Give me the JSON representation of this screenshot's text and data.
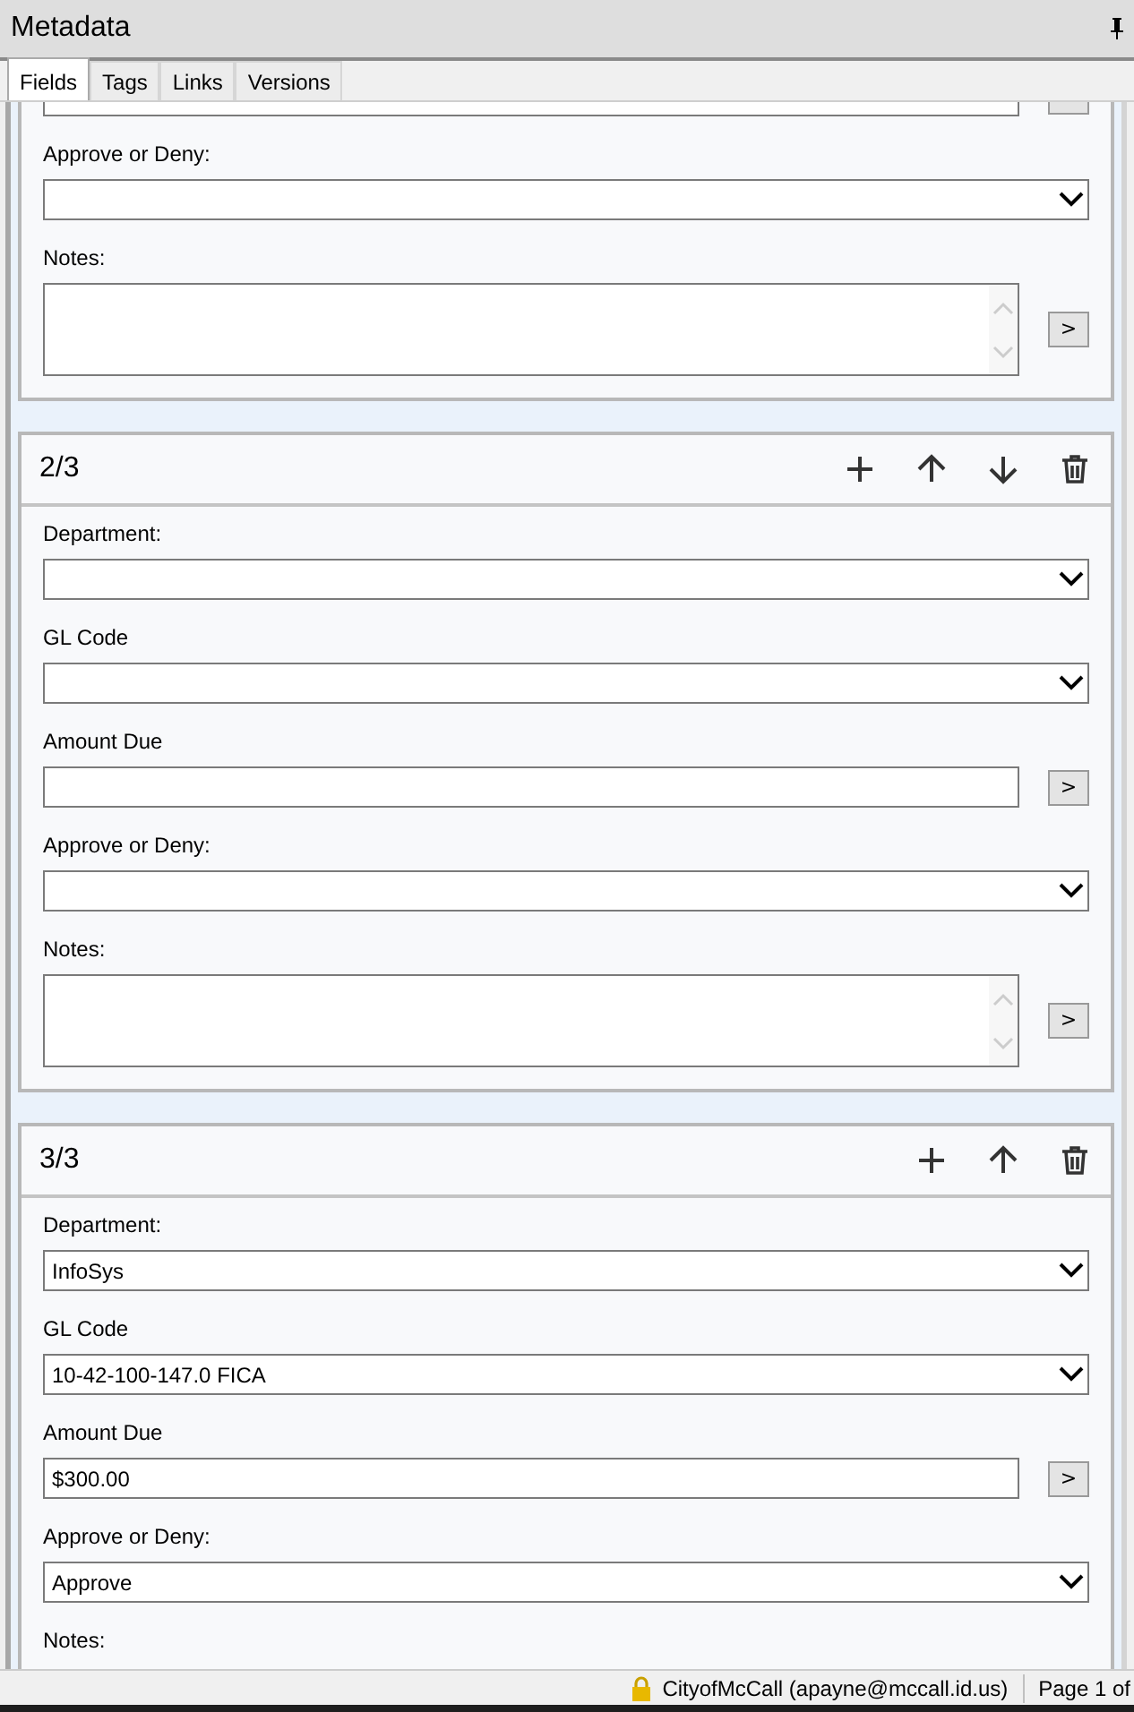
{
  "panel": {
    "title": "Metadata"
  },
  "tabs": [
    {
      "label": "Fields",
      "selected": true
    },
    {
      "label": "Tags",
      "selected": false
    },
    {
      "label": "Links",
      "selected": false
    },
    {
      "label": "Versions",
      "selected": false
    }
  ],
  "sections": [
    {
      "fields": [
        {
          "kind": "text"
        },
        {
          "kind": "select",
          "label": "Approve or Deny:"
        },
        {
          "kind": "textarea",
          "label": "Notes:",
          "button": ">"
        }
      ]
    },
    {
      "title": "2/3",
      "actions": [
        {
          "kind": "add"
        },
        {
          "kind": "up"
        },
        {
          "kind": "down"
        },
        {
          "kind": "delete"
        }
      ],
      "fields": [
        {
          "kind": "select",
          "label": "Department:"
        },
        {
          "kind": "select",
          "label": "GL Code"
        },
        {
          "kind": "text",
          "label": "Amount Due",
          "button": ">"
        },
        {
          "kind": "select",
          "label": "Approve or Deny:"
        },
        {
          "kind": "textarea",
          "label": "Notes:",
          "button": ">"
        }
      ]
    },
    {
      "title": "3/3",
      "actions": [
        {
          "kind": "add"
        },
        {
          "kind": "up"
        },
        {
          "kind": "delete"
        }
      ],
      "fields": [
        {
          "kind": "select",
          "label": "Department:",
          "value": "InfoSys"
        },
        {
          "kind": "select",
          "label": "GL Code",
          "value": "10-42-100-147.0 FICA"
        },
        {
          "kind": "text",
          "label": "Amount Due",
          "value": "$300.00",
          "button": ">"
        },
        {
          "kind": "select",
          "label": "Approve or Deny:",
          "value": "Approve"
        },
        {
          "kind": "label",
          "label": "Notes:"
        }
      ]
    }
  ],
  "status_bar": {
    "user": "CityofMcCall (apayne@mccall.id.us)",
    "page": "Page 1 of"
  }
}
